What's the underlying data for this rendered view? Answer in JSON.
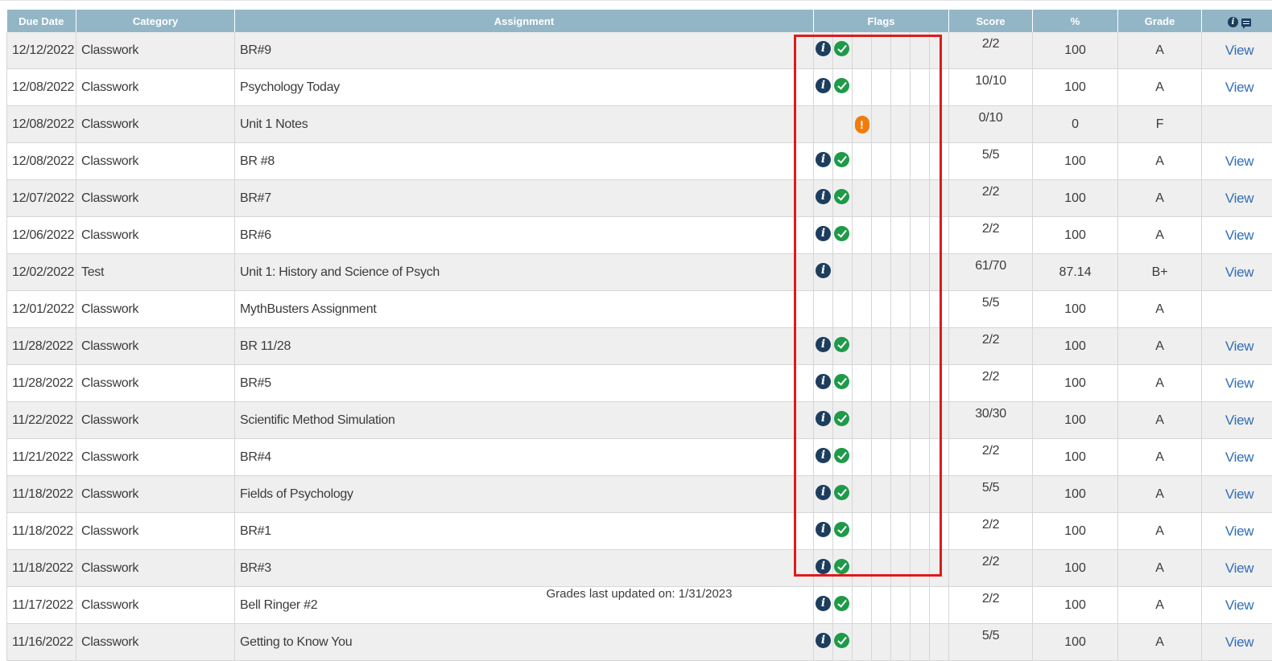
{
  "table": {
    "headers": {
      "due_date": "Due Date",
      "category": "Category",
      "assignment": "Assignment",
      "flags": "Flags",
      "score": "Score",
      "percent": "%",
      "grade": "Grade",
      "actions_icons": [
        "info-icon",
        "comment-icon"
      ]
    },
    "rows": [
      {
        "due_date": "12/12/2022",
        "category": "Classwork",
        "assignment": "BR#9",
        "flags": [
          "info",
          "check"
        ],
        "score": "2/2",
        "percent": "100",
        "grade": "A",
        "action": "View"
      },
      {
        "due_date": "12/08/2022",
        "category": "Classwork",
        "assignment": "Psychology Today",
        "flags": [
          "info",
          "check"
        ],
        "score": "10/10",
        "percent": "100",
        "grade": "A",
        "action": "View"
      },
      {
        "due_date": "12/08/2022",
        "category": "Classwork",
        "assignment": "Unit 1 Notes",
        "flags": [
          "missing"
        ],
        "score": "0/10",
        "percent": "0",
        "grade": "F",
        "action": ""
      },
      {
        "due_date": "12/08/2022",
        "category": "Classwork",
        "assignment": "BR #8",
        "flags": [
          "info",
          "check"
        ],
        "score": "5/5",
        "percent": "100",
        "grade": "A",
        "action": "View"
      },
      {
        "due_date": "12/07/2022",
        "category": "Classwork",
        "assignment": "BR#7",
        "flags": [
          "info",
          "check"
        ],
        "score": "2/2",
        "percent": "100",
        "grade": "A",
        "action": "View"
      },
      {
        "due_date": "12/06/2022",
        "category": "Classwork",
        "assignment": "BR#6",
        "flags": [
          "info",
          "check"
        ],
        "score": "2/2",
        "percent": "100",
        "grade": "A",
        "action": "View"
      },
      {
        "due_date": "12/02/2022",
        "category": "Test",
        "assignment": "Unit 1: History and Science of Psych",
        "flags": [
          "info"
        ],
        "score": "61/70",
        "percent": "87.14",
        "grade": "B+",
        "action": "View"
      },
      {
        "due_date": "12/01/2022",
        "category": "Classwork",
        "assignment": "MythBusters Assignment",
        "flags": [],
        "score": "5/5",
        "percent": "100",
        "grade": "A",
        "action": ""
      },
      {
        "due_date": "11/28/2022",
        "category": "Classwork",
        "assignment": "BR 11/28",
        "flags": [
          "info",
          "check"
        ],
        "score": "2/2",
        "percent": "100",
        "grade": "A",
        "action": "View"
      },
      {
        "due_date": "11/28/2022",
        "category": "Classwork",
        "assignment": "BR#5",
        "flags": [
          "info",
          "check"
        ],
        "score": "2/2",
        "percent": "100",
        "grade": "A",
        "action": "View"
      },
      {
        "due_date": "11/22/2022",
        "category": "Classwork",
        "assignment": "Scientific Method Simulation",
        "flags": [
          "info",
          "check"
        ],
        "score": "30/30",
        "percent": "100",
        "grade": "A",
        "action": "View"
      },
      {
        "due_date": "11/21/2022",
        "category": "Classwork",
        "assignment": "BR#4",
        "flags": [
          "info",
          "check"
        ],
        "score": "2/2",
        "percent": "100",
        "grade": "A",
        "action": "View"
      },
      {
        "due_date": "11/18/2022",
        "category": "Classwork",
        "assignment": "Fields of Psychology",
        "flags": [
          "info",
          "check"
        ],
        "score": "5/5",
        "percent": "100",
        "grade": "A",
        "action": "View"
      },
      {
        "due_date": "11/18/2022",
        "category": "Classwork",
        "assignment": "BR#1",
        "flags": [
          "info",
          "check"
        ],
        "score": "2/2",
        "percent": "100",
        "grade": "A",
        "action": "View"
      },
      {
        "due_date": "11/18/2022",
        "category": "Classwork",
        "assignment": "BR#3",
        "flags": [
          "info",
          "check"
        ],
        "score": "2/2",
        "percent": "100",
        "grade": "A",
        "action": "View"
      },
      {
        "due_date": "11/17/2022",
        "category": "Classwork",
        "assignment": "Bell Ringer #2",
        "flags": [
          "info",
          "check"
        ],
        "score": "2/2",
        "percent": "100",
        "grade": "A",
        "action": "View"
      },
      {
        "due_date": "11/16/2022",
        "category": "Classwork",
        "assignment": "Getting to Know You",
        "flags": [
          "info",
          "check"
        ],
        "score": "5/5",
        "percent": "100",
        "grade": "A",
        "action": "View"
      }
    ]
  },
  "footer": {
    "text": "Grades last updated on: 1/31/2023"
  },
  "colors": {
    "header_bg": "#93b6c7",
    "info_icon": "#1c3d5e",
    "check_icon": "#1e9a49",
    "missing_icon": "#ee7d0e",
    "link": "#2f6eb5",
    "highlight_box": "#e01a1a"
  }
}
